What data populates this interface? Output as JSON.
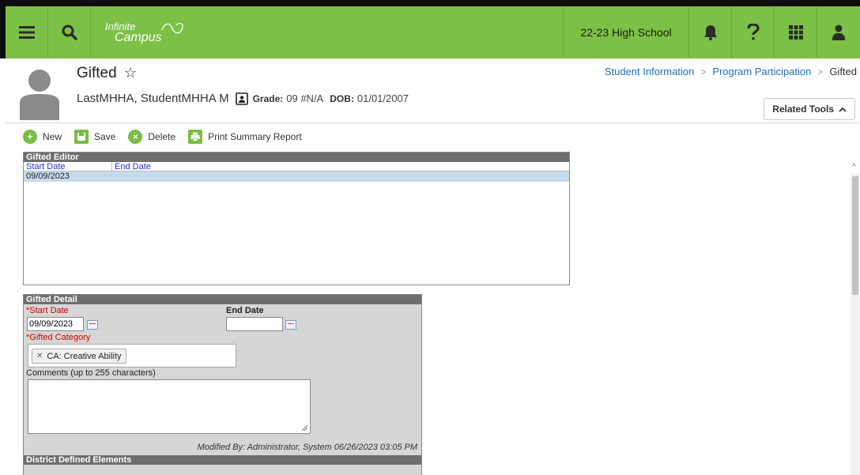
{
  "topbar": {
    "logo_line1": "Infinite",
    "logo_line2": "Campus",
    "school": "22-23 High School"
  },
  "header": {
    "title": "Gifted",
    "student_name": "LastMHHA, StudentMHHA M",
    "grade_label": "Grade:",
    "grade_value": "09 #N/A",
    "dob_label": "DOB:",
    "dob_value": "01/01/2007",
    "breadcrumb": [
      "Student Information",
      "Program Participation",
      "Gifted"
    ],
    "related_tools": "Related Tools"
  },
  "actions": {
    "new": "New",
    "save": "Save",
    "delete": "Delete",
    "print": "Print Summary Report"
  },
  "editor": {
    "title": "Gifted Editor",
    "columns": [
      "Start Date",
      "End Date"
    ],
    "rows": [
      {
        "start": "09/09/2023",
        "end": ""
      }
    ]
  },
  "detail": {
    "title": "Gifted Detail",
    "start_date_label": "*Start Date",
    "start_date_value": "09/09/2023",
    "end_date_label": "End Date",
    "end_date_value": "",
    "category_label": "*Gifted Category",
    "category_tag": "CA: Creative Ability",
    "comments_label": "Comments (up to 255 characters)",
    "comments_value": "",
    "modified": "Modified By: Administrator, System 06/26/2023 03:05 PM",
    "district_title": "District Defined Elements"
  },
  "colors": {
    "brand_green": "#7cc046",
    "link_blue": "#1d6fb8",
    "selected_row": "#c6dced",
    "panel_header": "#6e6e6e",
    "required_red": "#d40000"
  }
}
